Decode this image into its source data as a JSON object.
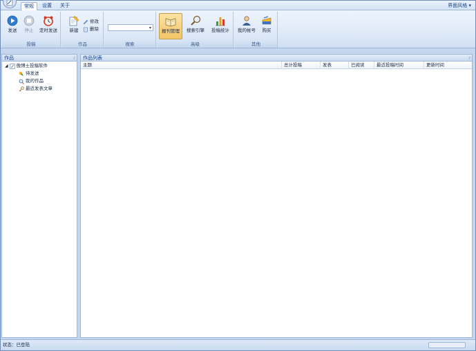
{
  "tabs": [
    {
      "label": "常规",
      "active": true
    },
    {
      "label": "设置",
      "active": false
    },
    {
      "label": "关于",
      "active": false
    }
  ],
  "style_menu": {
    "label": "界面风格",
    "arrow": "▾"
  },
  "ribbon": {
    "groups": {
      "post": {
        "label": "投稿",
        "buttons": [
          {
            "label": "发送",
            "icon": "play-icon",
            "disabled": false
          },
          {
            "label": "停止",
            "icon": "stop-icon",
            "disabled": true
          },
          {
            "label": "定时发送",
            "icon": "alarm-clock-icon",
            "disabled": false
          }
        ]
      },
      "works": {
        "label": "作品",
        "new_label": "新建",
        "edit_label": "修改",
        "delete_label": "删除"
      },
      "search": {
        "label": "搜索",
        "combo_value": ""
      },
      "advanced": {
        "label": "高级",
        "buttons": [
          {
            "label": "报刊管理",
            "icon": "book-icon",
            "pressed": true
          },
          {
            "label": "搜索引擎",
            "icon": "magnifier-icon",
            "pressed": false
          },
          {
            "label": "投稿统计",
            "icon": "bar-chart-icon",
            "pressed": false
          }
        ]
      },
      "other": {
        "label": "其他",
        "buttons": [
          {
            "label": "我的帐号",
            "icon": "user-icon"
          },
          {
            "label": "购买",
            "icon": "cart-icon"
          }
        ]
      }
    }
  },
  "left_panel": {
    "title": "作品",
    "tree": {
      "root_label": "傲博士投稿软件",
      "children": [
        {
          "label": "待发送",
          "icon": "pending-icon"
        },
        {
          "label": "我的作品",
          "icon": "search-works-icon"
        },
        {
          "label": "最近发表文章",
          "icon": "key-icon"
        }
      ]
    }
  },
  "right_panel": {
    "title": "作品列表",
    "columns": [
      "主题",
      "总计投稿",
      "发表",
      "已阅读",
      "最近投稿时间",
      "更新时间"
    ]
  },
  "status": {
    "text": "状态：已登陆"
  }
}
